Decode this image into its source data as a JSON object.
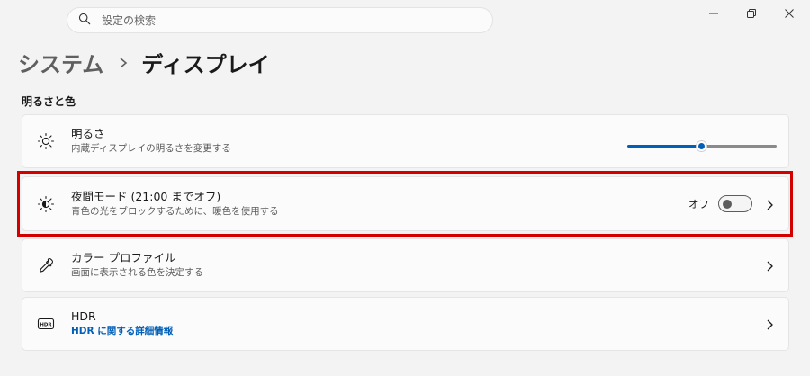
{
  "search": {
    "placeholder": "設定の検索"
  },
  "window_controls": {
    "minimize": "minimize-icon",
    "restore": "restore-icon",
    "close": "close-icon"
  },
  "breadcrumb": {
    "parent": "システム",
    "current": "ディスプレイ"
  },
  "section": {
    "title": "明るさと色"
  },
  "items": [
    {
      "title": "明るさ",
      "subtitle": "内蔵ディスプレイの明るさを変更する",
      "icon": "brightness-icon",
      "slider_value": 50
    },
    {
      "title": "夜間モード (21:00 までオフ)",
      "subtitle": "青色の光をブロックするために、暖色を使用する",
      "icon": "night-light-icon",
      "toggle_label": "オフ",
      "toggle_on": false
    },
    {
      "title": "カラー プロファイル",
      "subtitle": "画面に表示される色を決定する",
      "icon": "eyedropper-icon"
    },
    {
      "title": "HDR",
      "subtitle": "HDR に関する詳細情報",
      "icon": "hdr-icon"
    }
  ],
  "colors": {
    "accent": "#005fb8",
    "highlight": "#d40000",
    "background": "#f3f3f3",
    "card": "#fbfbfb"
  }
}
